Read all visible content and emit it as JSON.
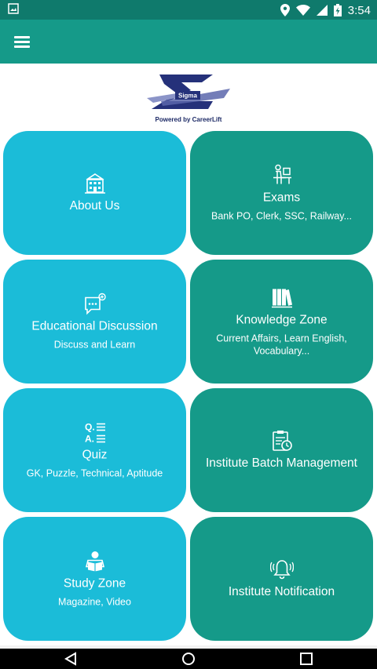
{
  "status_bar": {
    "time": "3:54"
  },
  "app_bar": {
    "menu_icon": "hamburger-menu-icon"
  },
  "logo": {
    "brand": "Sigma",
    "caption": "Powered by CareerLift"
  },
  "tiles": [
    {
      "title": "About Us",
      "subtitle": "",
      "icon": "institute-building-icon",
      "color": "#1bbcd8"
    },
    {
      "title": "Exams",
      "subtitle": "Bank PO, Clerk, SSC, Railway...",
      "icon": "student-desk-icon",
      "color": "#159a89"
    },
    {
      "title": "Educational Discussion",
      "subtitle": "Discuss and Learn",
      "icon": "chat-bubble-icon",
      "color": "#1bbcd8"
    },
    {
      "title": "Knowledge Zone",
      "subtitle": "Current Affairs, Learn English, Vocabulary...",
      "icon": "books-icon",
      "color": "#159a89"
    },
    {
      "title": "Quiz",
      "subtitle": "GK, Puzzle, Technical, Aptitude",
      "icon": "qa-list-icon",
      "color": "#1bbcd8"
    },
    {
      "title": "Institute Batch Management",
      "subtitle": "",
      "icon": "clipboard-clock-icon",
      "color": "#159a89"
    },
    {
      "title": "Study Zone",
      "subtitle": "Magazine, Video",
      "icon": "reader-icon",
      "color": "#1bbcd8"
    },
    {
      "title": "Institute Notification",
      "subtitle": "",
      "icon": "bell-ringing-icon",
      "color": "#159a89"
    }
  ],
  "nav_bar": {
    "back": "back-icon",
    "home": "home-icon",
    "recents": "recents-icon"
  }
}
